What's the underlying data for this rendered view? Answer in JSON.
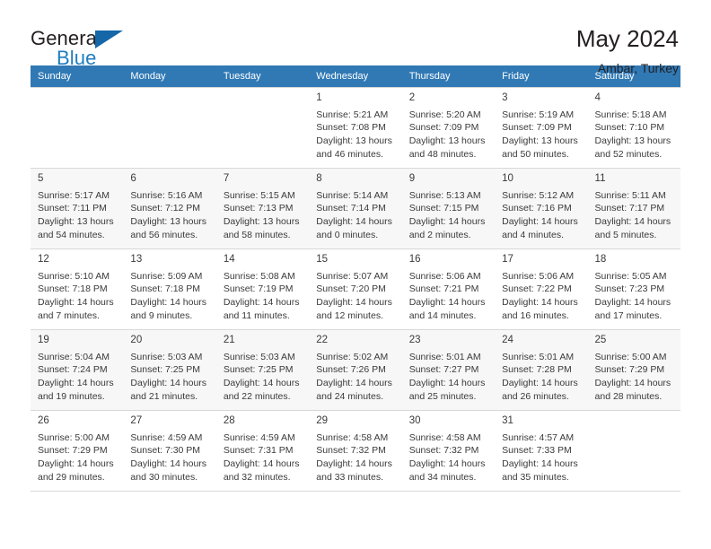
{
  "brand": {
    "word_one": "General",
    "word_two": "Blue",
    "flag_icon": "triangle-flag-icon"
  },
  "header": {
    "title": "May 2024",
    "location": "Ambar, Turkey"
  },
  "colors": {
    "header_bar": "#3079b5",
    "brand_blue": "#1f7dc0",
    "alt_row": "#f7f7f7",
    "grid_line": "#d8d8d8"
  },
  "calendar": {
    "weekdays": [
      "Sunday",
      "Monday",
      "Tuesday",
      "Wednesday",
      "Thursday",
      "Friday",
      "Saturday"
    ],
    "weeks": [
      [
        {
          "day": "",
          "empty": true
        },
        {
          "day": "",
          "empty": true
        },
        {
          "day": "",
          "empty": true
        },
        {
          "day": "1",
          "sunrise": "Sunrise: 5:21 AM",
          "sunset": "Sunset: 7:08 PM",
          "daylight1": "Daylight: 13 hours",
          "daylight2": "and 46 minutes."
        },
        {
          "day": "2",
          "sunrise": "Sunrise: 5:20 AM",
          "sunset": "Sunset: 7:09 PM",
          "daylight1": "Daylight: 13 hours",
          "daylight2": "and 48 minutes."
        },
        {
          "day": "3",
          "sunrise": "Sunrise: 5:19 AM",
          "sunset": "Sunset: 7:09 PM",
          "daylight1": "Daylight: 13 hours",
          "daylight2": "and 50 minutes."
        },
        {
          "day": "4",
          "sunrise": "Sunrise: 5:18 AM",
          "sunset": "Sunset: 7:10 PM",
          "daylight1": "Daylight: 13 hours",
          "daylight2": "and 52 minutes."
        }
      ],
      [
        {
          "day": "5",
          "sunrise": "Sunrise: 5:17 AM",
          "sunset": "Sunset: 7:11 PM",
          "daylight1": "Daylight: 13 hours",
          "daylight2": "and 54 minutes."
        },
        {
          "day": "6",
          "sunrise": "Sunrise: 5:16 AM",
          "sunset": "Sunset: 7:12 PM",
          "daylight1": "Daylight: 13 hours",
          "daylight2": "and 56 minutes."
        },
        {
          "day": "7",
          "sunrise": "Sunrise: 5:15 AM",
          "sunset": "Sunset: 7:13 PM",
          "daylight1": "Daylight: 13 hours",
          "daylight2": "and 58 minutes."
        },
        {
          "day": "8",
          "sunrise": "Sunrise: 5:14 AM",
          "sunset": "Sunset: 7:14 PM",
          "daylight1": "Daylight: 14 hours",
          "daylight2": "and 0 minutes."
        },
        {
          "day": "9",
          "sunrise": "Sunrise: 5:13 AM",
          "sunset": "Sunset: 7:15 PM",
          "daylight1": "Daylight: 14 hours",
          "daylight2": "and 2 minutes."
        },
        {
          "day": "10",
          "sunrise": "Sunrise: 5:12 AM",
          "sunset": "Sunset: 7:16 PM",
          "daylight1": "Daylight: 14 hours",
          "daylight2": "and 4 minutes."
        },
        {
          "day": "11",
          "sunrise": "Sunrise: 5:11 AM",
          "sunset": "Sunset: 7:17 PM",
          "daylight1": "Daylight: 14 hours",
          "daylight2": "and 5 minutes."
        }
      ],
      [
        {
          "day": "12",
          "sunrise": "Sunrise: 5:10 AM",
          "sunset": "Sunset: 7:18 PM",
          "daylight1": "Daylight: 14 hours",
          "daylight2": "and 7 minutes."
        },
        {
          "day": "13",
          "sunrise": "Sunrise: 5:09 AM",
          "sunset": "Sunset: 7:18 PM",
          "daylight1": "Daylight: 14 hours",
          "daylight2": "and 9 minutes."
        },
        {
          "day": "14",
          "sunrise": "Sunrise: 5:08 AM",
          "sunset": "Sunset: 7:19 PM",
          "daylight1": "Daylight: 14 hours",
          "daylight2": "and 11 minutes."
        },
        {
          "day": "15",
          "sunrise": "Sunrise: 5:07 AM",
          "sunset": "Sunset: 7:20 PM",
          "daylight1": "Daylight: 14 hours",
          "daylight2": "and 12 minutes."
        },
        {
          "day": "16",
          "sunrise": "Sunrise: 5:06 AM",
          "sunset": "Sunset: 7:21 PM",
          "daylight1": "Daylight: 14 hours",
          "daylight2": "and 14 minutes."
        },
        {
          "day": "17",
          "sunrise": "Sunrise: 5:06 AM",
          "sunset": "Sunset: 7:22 PM",
          "daylight1": "Daylight: 14 hours",
          "daylight2": "and 16 minutes."
        },
        {
          "day": "18",
          "sunrise": "Sunrise: 5:05 AM",
          "sunset": "Sunset: 7:23 PM",
          "daylight1": "Daylight: 14 hours",
          "daylight2": "and 17 minutes."
        }
      ],
      [
        {
          "day": "19",
          "sunrise": "Sunrise: 5:04 AM",
          "sunset": "Sunset: 7:24 PM",
          "daylight1": "Daylight: 14 hours",
          "daylight2": "and 19 minutes."
        },
        {
          "day": "20",
          "sunrise": "Sunrise: 5:03 AM",
          "sunset": "Sunset: 7:25 PM",
          "daylight1": "Daylight: 14 hours",
          "daylight2": "and 21 minutes."
        },
        {
          "day": "21",
          "sunrise": "Sunrise: 5:03 AM",
          "sunset": "Sunset: 7:25 PM",
          "daylight1": "Daylight: 14 hours",
          "daylight2": "and 22 minutes."
        },
        {
          "day": "22",
          "sunrise": "Sunrise: 5:02 AM",
          "sunset": "Sunset: 7:26 PM",
          "daylight1": "Daylight: 14 hours",
          "daylight2": "and 24 minutes."
        },
        {
          "day": "23",
          "sunrise": "Sunrise: 5:01 AM",
          "sunset": "Sunset: 7:27 PM",
          "daylight1": "Daylight: 14 hours",
          "daylight2": "and 25 minutes."
        },
        {
          "day": "24",
          "sunrise": "Sunrise: 5:01 AM",
          "sunset": "Sunset: 7:28 PM",
          "daylight1": "Daylight: 14 hours",
          "daylight2": "and 26 minutes."
        },
        {
          "day": "25",
          "sunrise": "Sunrise: 5:00 AM",
          "sunset": "Sunset: 7:29 PM",
          "daylight1": "Daylight: 14 hours",
          "daylight2": "and 28 minutes."
        }
      ],
      [
        {
          "day": "26",
          "sunrise": "Sunrise: 5:00 AM",
          "sunset": "Sunset: 7:29 PM",
          "daylight1": "Daylight: 14 hours",
          "daylight2": "and 29 minutes."
        },
        {
          "day": "27",
          "sunrise": "Sunrise: 4:59 AM",
          "sunset": "Sunset: 7:30 PM",
          "daylight1": "Daylight: 14 hours",
          "daylight2": "and 30 minutes."
        },
        {
          "day": "28",
          "sunrise": "Sunrise: 4:59 AM",
          "sunset": "Sunset: 7:31 PM",
          "daylight1": "Daylight: 14 hours",
          "daylight2": "and 32 minutes."
        },
        {
          "day": "29",
          "sunrise": "Sunrise: 4:58 AM",
          "sunset": "Sunset: 7:32 PM",
          "daylight1": "Daylight: 14 hours",
          "daylight2": "and 33 minutes."
        },
        {
          "day": "30",
          "sunrise": "Sunrise: 4:58 AM",
          "sunset": "Sunset: 7:32 PM",
          "daylight1": "Daylight: 14 hours",
          "daylight2": "and 34 minutes."
        },
        {
          "day": "31",
          "sunrise": "Sunrise: 4:57 AM",
          "sunset": "Sunset: 7:33 PM",
          "daylight1": "Daylight: 14 hours",
          "daylight2": "and 35 minutes."
        },
        {
          "day": "",
          "empty": true
        }
      ]
    ]
  }
}
